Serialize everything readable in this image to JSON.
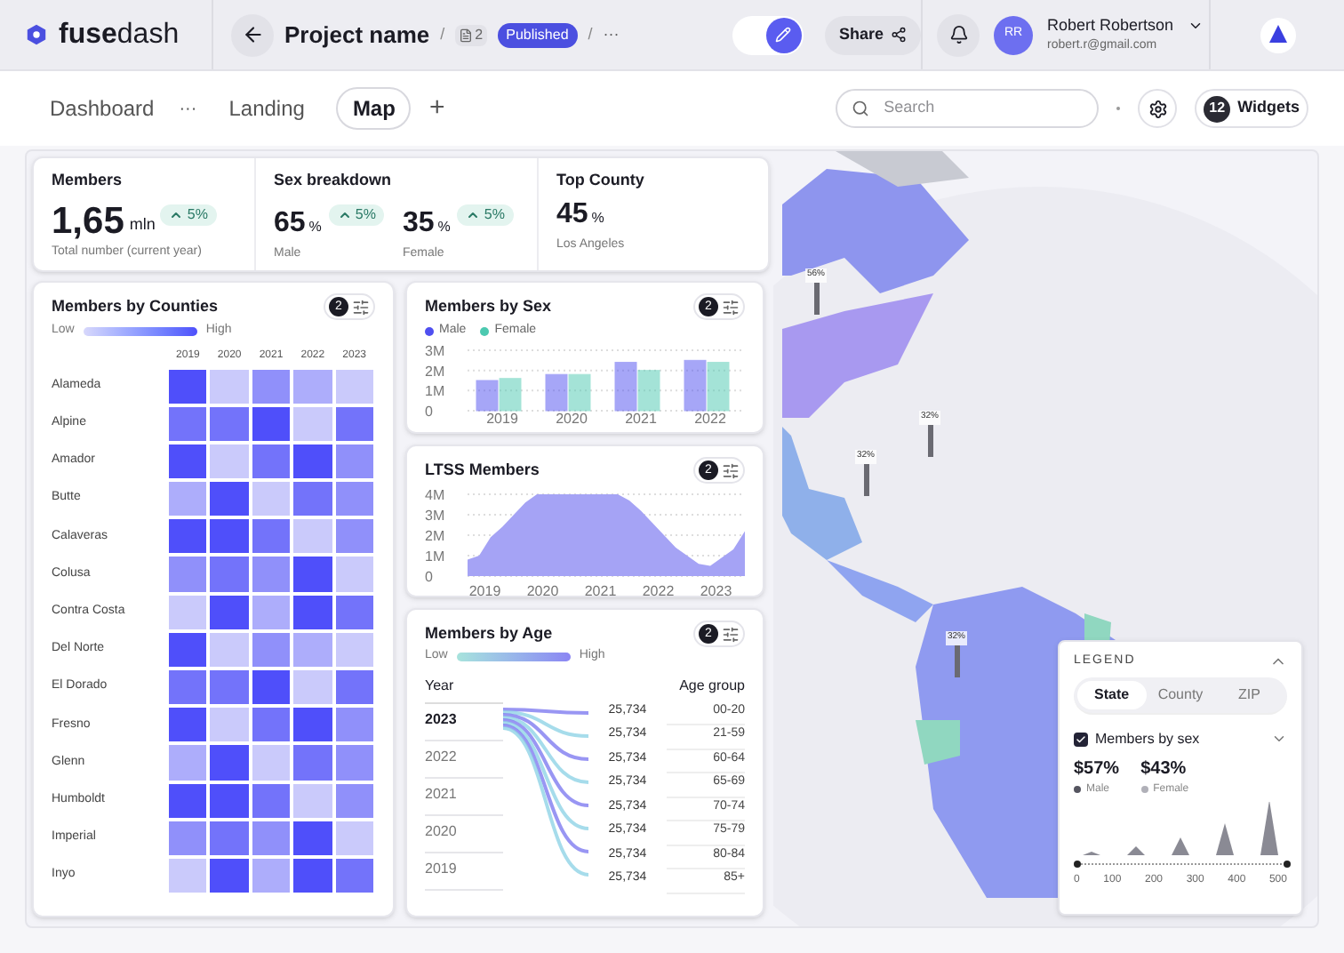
{
  "header": {
    "logo": "**fuse**dash",
    "project_title": "Project name",
    "separator_1": "/",
    "pages_count": "2",
    "status_badge": "Published",
    "separator_2": "/",
    "more": "···",
    "edit_mode": {
      "on": true
    },
    "share_button": "Share",
    "user": {
      "initials": "RR",
      "name": "Robert Robertson",
      "email": "robert.r@gmail.com"
    }
  },
  "tabs": [
    {
      "label": "Dashboard",
      "selected": false,
      "more": "···"
    },
    {
      "label": "Landing",
      "selected": false
    },
    {
      "label": "Map",
      "selected": true
    }
  ],
  "add_tab": "+",
  "search": {
    "placeholder": "Search"
  },
  "widgets_button": {
    "count": "12",
    "label": "Widgets"
  },
  "stats": {
    "members": {
      "title": "Members",
      "value": "1,65",
      "unit": "mln",
      "trend": "5%",
      "caption": "Total number (current year)"
    },
    "sex_breakdown": {
      "title": "Sex breakdown",
      "items": [
        {
          "value": "65",
          "unit": "%",
          "trend": "5%",
          "caption": "Male"
        },
        {
          "value": "35",
          "unit": "%",
          "trend": "5%",
          "caption": "Female"
        }
      ]
    },
    "top_county": {
      "title": "Top County",
      "value": "45",
      "unit": "%",
      "caption": "Los Angeles"
    }
  },
  "counties_card": {
    "title": "Members by Counties",
    "filter_count": "2",
    "scale_low": "Low",
    "scale_high": "High",
    "years": [
      "2019",
      "2020",
      "2021",
      "2022",
      "2023"
    ],
    "rows": [
      {
        "name": "Alameda",
        "cells": [
          {
            "color": "#4f4ffa"
          },
          {
            "color": "#cacafb"
          },
          {
            "color": "#9090fa"
          },
          {
            "color": "#adadfb"
          },
          {
            "color": "#cacafb"
          }
        ]
      },
      {
        "name": "Alpine",
        "cells": [
          {
            "color": "#7373fa"
          },
          {
            "color": "#7373fa"
          },
          {
            "color": "#4f4ffa"
          },
          {
            "color": "#cacafb"
          },
          {
            "color": "#7373fa"
          }
        ]
      },
      {
        "name": "Amador",
        "cells": [
          {
            "color": "#4f4ffa"
          },
          {
            "color": "#cacafb"
          },
          {
            "color": "#7373fa"
          },
          {
            "color": "#4f4ffa"
          },
          {
            "color": "#9090fa"
          }
        ]
      },
      {
        "name": "Butte",
        "cells": [
          {
            "color": "#adadfb"
          },
          {
            "color": "#4f4ffa"
          },
          {
            "color": "#cacafb"
          },
          {
            "color": "#7373fa"
          },
          {
            "color": "#9090fa"
          }
        ]
      },
      {
        "name": "Calaveras",
        "cells": [
          {
            "color": "#4f4ffa"
          },
          {
            "color": "#4f4ffa"
          },
          {
            "color": "#7373fa"
          },
          {
            "color": "#cacafb"
          },
          {
            "color": "#9090fa"
          }
        ]
      },
      {
        "name": "Colusa",
        "cells": [
          {
            "color": "#9090fa"
          },
          {
            "color": "#7373fa"
          },
          {
            "color": "#9090fa"
          },
          {
            "color": "#4f4ffa"
          },
          {
            "color": "#cacafb"
          }
        ]
      },
      {
        "name": "Contra Costa",
        "cells": [
          {
            "color": "#cacafb"
          },
          {
            "color": "#4f4ffa"
          },
          {
            "color": "#adadfb"
          },
          {
            "color": "#4f4ffa"
          },
          {
            "color": "#7373fa"
          }
        ]
      },
      {
        "name": "Del Norte",
        "cells": [
          {
            "color": "#4f4ffa"
          },
          {
            "color": "#cacafb"
          },
          {
            "color": "#9090fa"
          },
          {
            "color": "#adadfb"
          },
          {
            "color": "#cacafb"
          }
        ]
      },
      {
        "name": "El Dorado",
        "cells": [
          {
            "color": "#7373fa"
          },
          {
            "color": "#7373fa"
          },
          {
            "color": "#4f4ffa"
          },
          {
            "color": "#cacafb"
          },
          {
            "color": "#7373fa"
          }
        ]
      },
      {
        "name": "Fresno",
        "cells": [
          {
            "color": "#4f4ffa"
          },
          {
            "color": "#cacafb"
          },
          {
            "color": "#7373fa"
          },
          {
            "color": "#4f4ffa"
          },
          {
            "color": "#9090fa"
          }
        ]
      },
      {
        "name": "Glenn",
        "cells": [
          {
            "color": "#adadfb"
          },
          {
            "color": "#4f4ffa"
          },
          {
            "color": "#cacafb"
          },
          {
            "color": "#7373fa"
          },
          {
            "color": "#9090fa"
          }
        ]
      },
      {
        "name": "Humboldt",
        "cells": [
          {
            "color": "#4f4ffa"
          },
          {
            "color": "#4f4ffa"
          },
          {
            "color": "#7373fa"
          },
          {
            "color": "#cacafb"
          },
          {
            "color": "#9090fa"
          }
        ]
      },
      {
        "name": "Imperial",
        "cells": [
          {
            "color": "#9090fa"
          },
          {
            "color": "#7373fa"
          },
          {
            "color": "#9090fa"
          },
          {
            "color": "#4f4ffa"
          },
          {
            "color": "#cacafb"
          }
        ]
      },
      {
        "name": "Inyo",
        "cells": [
          {
            "color": "#cacafb"
          },
          {
            "color": "#4f4ffa"
          },
          {
            "color": "#adadfb"
          },
          {
            "color": "#4f4ffa"
          },
          {
            "color": "#7373fa"
          }
        ]
      }
    ]
  },
  "sex_card": {
    "title": "Members by Sex",
    "filter_count": "2",
    "chart_data": {
      "type": "bar",
      "grid": true,
      "categories": [
        "2019",
        "2020",
        "2021",
        "2022"
      ],
      "series": [
        {
          "name": "Male",
          "color": "#4f4ff0",
          "values": [
            1.5,
            1.8,
            2.4,
            2.5
          ]
        },
        {
          "name": "Female",
          "color": "#4cc9b0",
          "values": [
            1.6,
            1.8,
            2.0,
            2.4
          ]
        }
      ],
      "ylim": [
        0,
        3
      ],
      "yticks": [
        {
          "value": 0,
          "label": "0"
        },
        {
          "value": 1,
          "label": "1M"
        },
        {
          "value": 2,
          "label": "2M"
        },
        {
          "value": 3,
          "label": "3M"
        }
      ]
    }
  },
  "ltss_card": {
    "title": "LTSS Members",
    "filter_count": "2",
    "chart_data": {
      "type": "area",
      "grid": true,
      "x": [
        2018.7,
        2018.9,
        2019.1,
        2019.3,
        2019.5,
        2019.7,
        2019.9,
        2020.1,
        2020.3,
        2020.5,
        2020.7,
        2020.9,
        2021.1,
        2021.3,
        2021.5,
        2021.7,
        2021.9,
        2022.1,
        2022.3,
        2022.5,
        2022.7,
        2022.9,
        2023.1,
        2023.3,
        2023.5
      ],
      "series": [
        {
          "color": "#a5a3f5",
          "values": [
            0.8,
            1.0,
            1.9,
            2.4,
            3.0,
            3.6,
            4.0,
            4.0,
            4.0,
            4.0,
            4.0,
            4.0,
            4.0,
            4.0,
            3.7,
            3.2,
            2.6,
            2.0,
            1.4,
            1.0,
            0.6,
            0.5,
            0.9,
            1.3,
            2.2
          ]
        }
      ],
      "xlim": [
        2018.7,
        2023.5
      ],
      "ylim": [
        0,
        4
      ],
      "xticks": [
        2019,
        2020,
        2021,
        2022,
        2023
      ],
      "yticks": [
        {
          "value": 0,
          "label": "0"
        },
        {
          "value": 1,
          "label": "1M"
        },
        {
          "value": 2,
          "label": "2M"
        },
        {
          "value": 3,
          "label": "3M"
        },
        {
          "value": 4,
          "label": "4M"
        }
      ]
    }
  },
  "age_card": {
    "title": "Members by Age",
    "filter_count": "2",
    "scale_low": "Low",
    "scale_high": "High",
    "year_heading": "Year",
    "age_heading": "Age group",
    "years": [
      {
        "label": "2023",
        "selected": true
      },
      {
        "label": "2022",
        "selected": false
      },
      {
        "label": "2021",
        "selected": false
      },
      {
        "label": "2020",
        "selected": false
      },
      {
        "label": "2019",
        "selected": false
      }
    ],
    "values": [
      "25,734",
      "25,734",
      "25,734",
      "25,734",
      "25,734",
      "25,734",
      "25,734",
      "25,734"
    ],
    "age_groups": [
      "00-20",
      "21-59",
      "60-64",
      "65-69",
      "70-74",
      "75-79",
      "80-84",
      "85+"
    ]
  },
  "map": {
    "pins": [
      "56%",
      "32%",
      "32%",
      "32%"
    ]
  },
  "legend": {
    "title": "LEGEND",
    "tabs": [
      {
        "label": "State",
        "selected": true
      },
      {
        "label": "County",
        "selected": false
      },
      {
        "label": "ZIP",
        "selected": false
      }
    ],
    "layer": {
      "label": "Members by sex",
      "checked": true
    },
    "items": [
      {
        "value": "$57%",
        "label": "Male",
        "color": "#555560"
      },
      {
        "value": "$43%",
        "label": "Female",
        "color": "#b0b0b8"
      }
    ],
    "axis": [
      "0",
      "100",
      "200",
      "300",
      "400",
      "500"
    ]
  }
}
